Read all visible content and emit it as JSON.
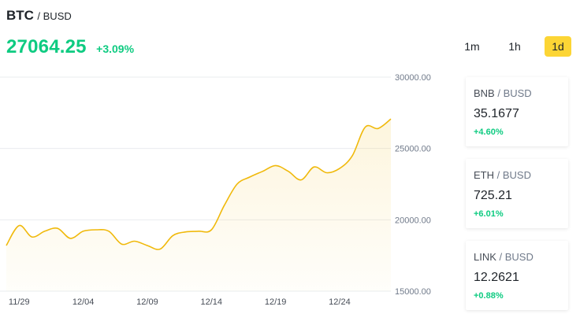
{
  "pair": {
    "base": "BTC",
    "quote": "BUSD"
  },
  "price": "27064.25",
  "change": "+3.09%",
  "timeframes": [
    {
      "label": "1m",
      "active": false
    },
    {
      "label": "1h",
      "active": false
    },
    {
      "label": "1d",
      "active": true
    }
  ],
  "colors": {
    "up": "#0ecb81",
    "line": "#f0b90b",
    "accent": "#fcd535"
  },
  "cards": [
    {
      "base": "BNB",
      "quote": "BUSD",
      "price": "35.1677",
      "change": "+4.60%"
    },
    {
      "base": "ETH",
      "quote": "BUSD",
      "price": "725.21",
      "change": "+6.01%"
    },
    {
      "base": "LINK",
      "quote": "BUSD",
      "price": "12.2621",
      "change": "+0.88%"
    }
  ],
  "chart_data": {
    "type": "area",
    "title": "",
    "xlabel": "",
    "ylabel": "",
    "ylim": [
      15000,
      30000
    ],
    "yticks": [
      "30000.00",
      "25000.00",
      "20000.00",
      "15000.00"
    ],
    "xticks": [
      "11/29",
      "12/04",
      "12/09",
      "12/14",
      "12/19",
      "12/24"
    ],
    "grid": true,
    "x": [
      "11/28",
      "11/29",
      "11/30",
      "12/01",
      "12/02",
      "12/03",
      "12/04",
      "12/05",
      "12/06",
      "12/07",
      "12/08",
      "12/09",
      "12/10",
      "12/11",
      "12/12",
      "12/13",
      "12/14",
      "12/15",
      "12/16",
      "12/17",
      "12/18",
      "12/19",
      "12/20",
      "12/21",
      "12/22",
      "12/23",
      "12/24",
      "12/25",
      "12/26",
      "12/27",
      "12/28"
    ],
    "values": [
      18200,
      19600,
      18800,
      19200,
      19400,
      18700,
      19200,
      19300,
      19200,
      18300,
      18500,
      18200,
      17950,
      18900,
      19150,
      19200,
      19300,
      21000,
      22500,
      23000,
      23400,
      23800,
      23400,
      22800,
      23700,
      23300,
      23600,
      24500,
      26500,
      26400,
      27064
    ]
  }
}
